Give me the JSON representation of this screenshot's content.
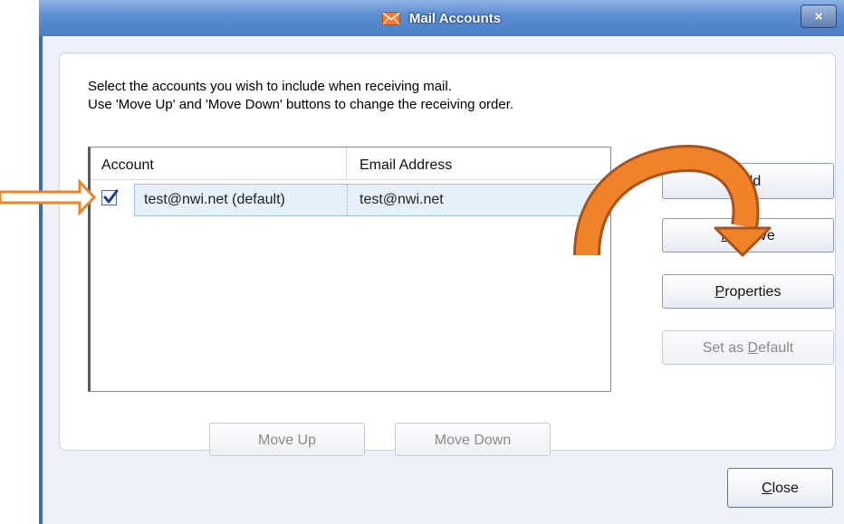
{
  "window": {
    "title": "Mail Accounts",
    "close_glyph": "×",
    "icon": "envelope-icon"
  },
  "intro": {
    "line1": "Select the accounts you wish to include when receiving mail.",
    "line2": "Use 'Move Up' and 'Move Down' buttons to change the receiving order."
  },
  "accounts_list": {
    "columns": [
      "Account",
      "Email Address"
    ],
    "rows": [
      {
        "checked": true,
        "account": "test@nwi.net (default)",
        "email": "test@nwi.net"
      }
    ]
  },
  "buttons": {
    "add": "Add",
    "remove": "Remove",
    "properties": "Properties",
    "set_default": "Set as Default",
    "move_up": "Move Up",
    "move_down": "Move Down",
    "close": "Close"
  },
  "colors": {
    "annotation": "#f0832a",
    "title_bar": "#5f8fd2"
  }
}
